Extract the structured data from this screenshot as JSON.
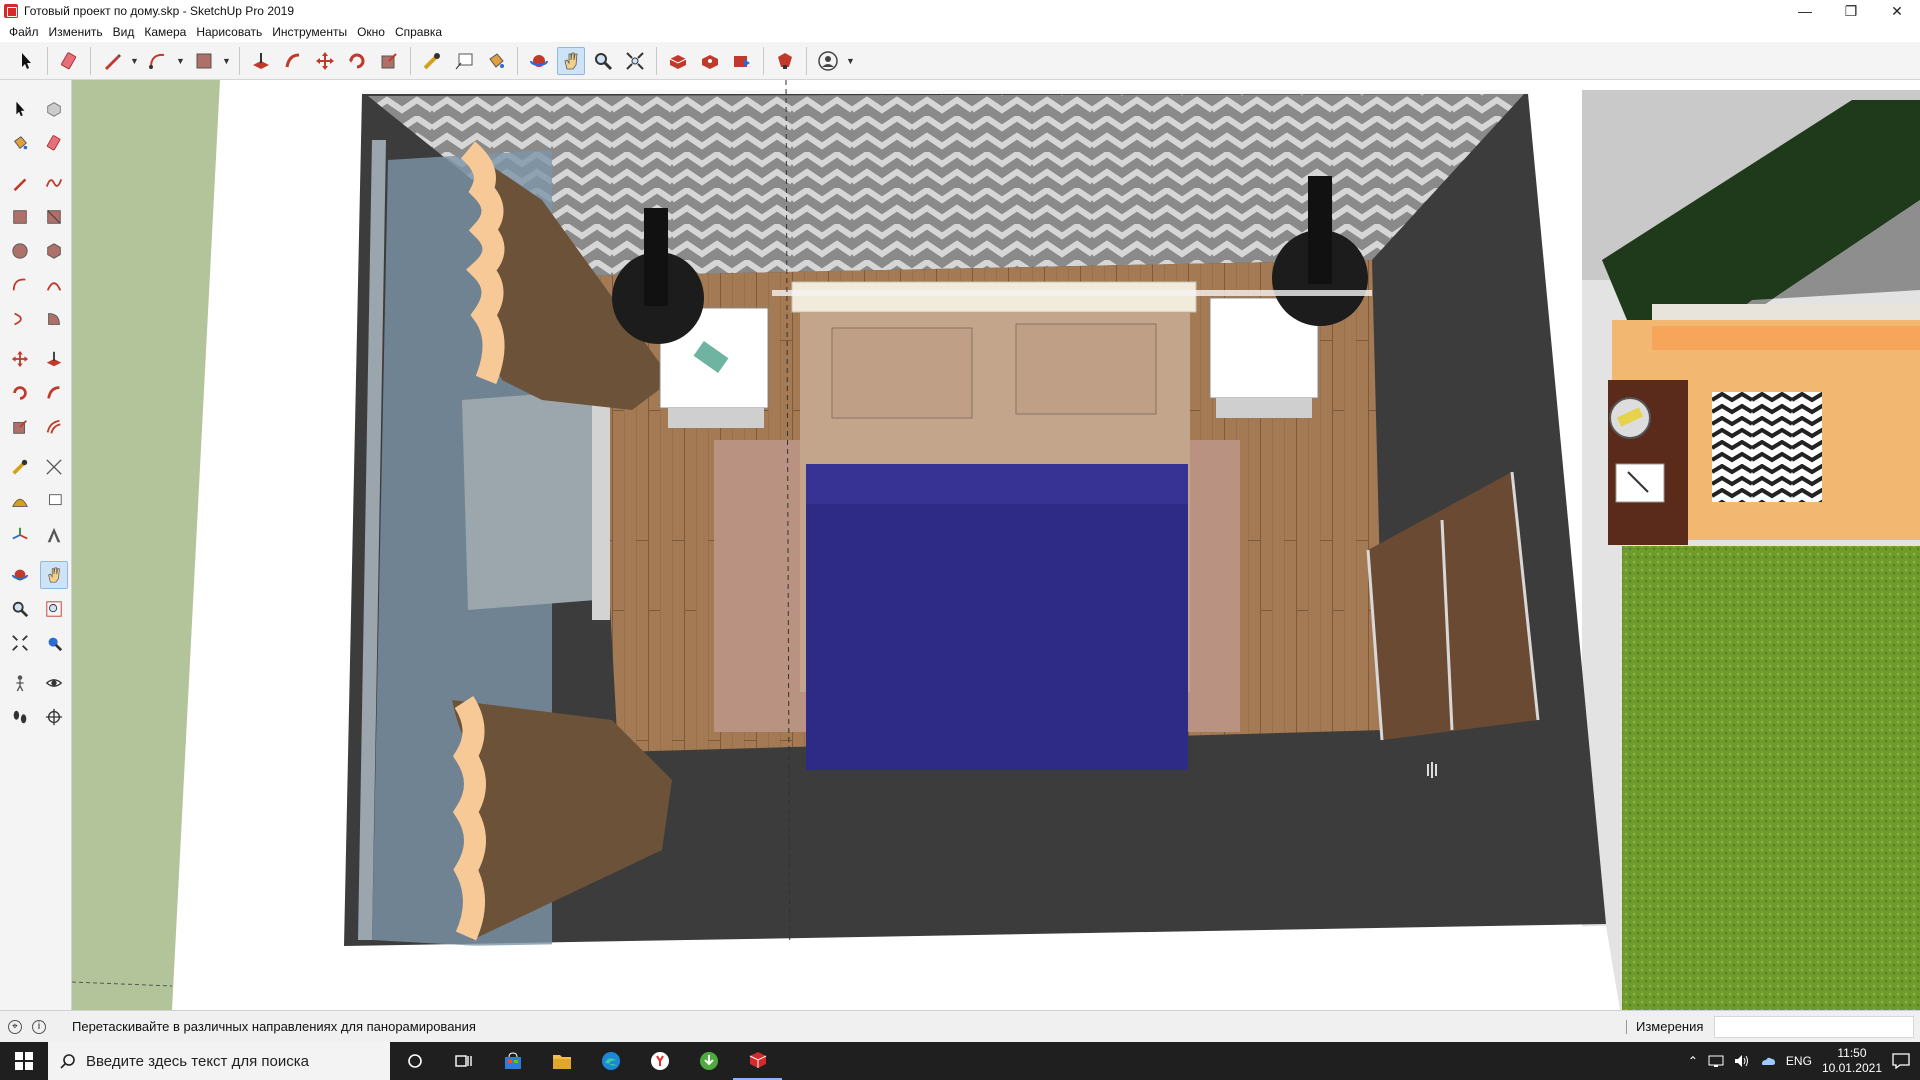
{
  "window": {
    "title": "Готовый проект по дому.skp - SketchUp Pro 2019",
    "controls": {
      "minimize": "—",
      "maximize": "❐",
      "close": "✕"
    }
  },
  "menu": [
    "Файл",
    "Изменить",
    "Вид",
    "Камера",
    "Нарисовать",
    "Инструменты",
    "Окно",
    "Справка"
  ],
  "toolbar": {
    "active_tool": "pan"
  },
  "status": {
    "hint": "Перетаскивайте в различных направлениях для панорамирования",
    "measurements_label": "Измерения",
    "measurements_value": ""
  },
  "taskbar": {
    "search_placeholder": "Введите здесь текст для поиска",
    "language": "ENG",
    "time": "11:50",
    "date": "10.01.2021"
  },
  "colors": {
    "accent": "#d42a2a",
    "floor": "#a37a54",
    "bedspread": "#2e2b86",
    "wall": "#3c3c3c",
    "lawn": "#6f9a2e"
  }
}
